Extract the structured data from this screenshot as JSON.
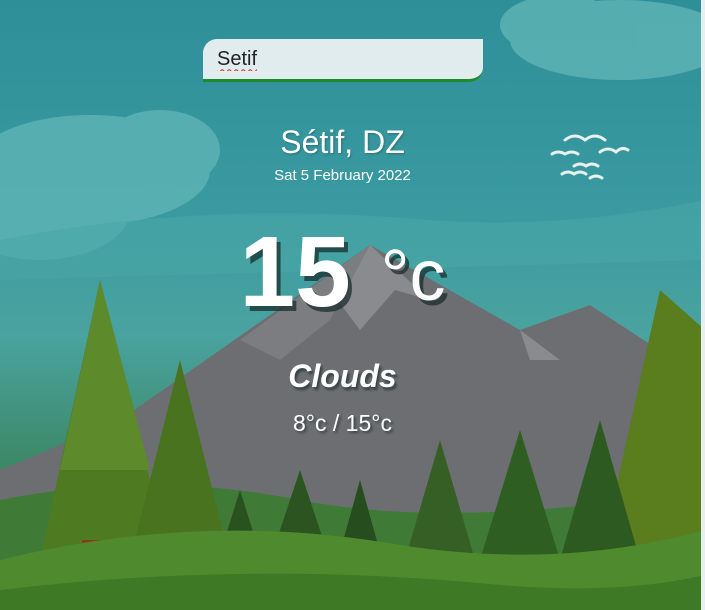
{
  "search": {
    "value": "Setif"
  },
  "location": {
    "city": "Sétif, DZ",
    "date": "Sat 5 February 2022"
  },
  "weather": {
    "temperature": "15",
    "unit": "°c",
    "condition": "Clouds",
    "range": "8°c / 15°c"
  },
  "colors": {
    "sky": "#3a9aa0",
    "search_underline": "#1f8a2c"
  }
}
